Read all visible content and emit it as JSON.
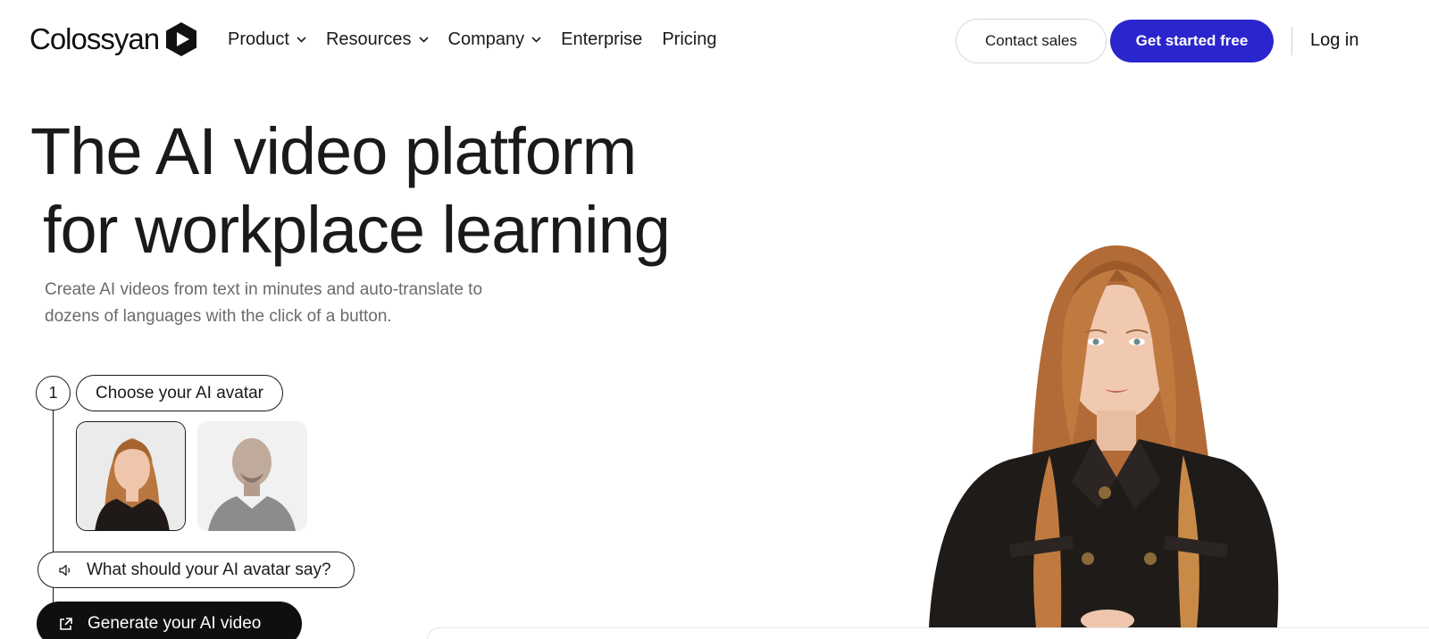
{
  "brand": {
    "name": "Colossyan",
    "accent": "#2a25cc"
  },
  "nav": {
    "links": [
      {
        "label": "Product",
        "has_dropdown": true
      },
      {
        "label": "Resources",
        "has_dropdown": true
      },
      {
        "label": "Company",
        "has_dropdown": true
      },
      {
        "label": "Enterprise",
        "has_dropdown": false
      },
      {
        "label": "Pricing",
        "has_dropdown": false
      }
    ],
    "contact_label": "Contact sales",
    "cta_label": "Get started free",
    "login_label": "Log in"
  },
  "hero": {
    "title_line1": "The AI video platform",
    "title_line2": "for workplace learning",
    "subtitle": "Create AI videos from text in minutes and auto-translate to dozens of languages with the click of a button."
  },
  "stepper": {
    "step_number": "1",
    "choose_label": "Choose your AI avatar",
    "avatars": [
      {
        "name": "woman-avatar",
        "selected": true
      },
      {
        "name": "man-avatar",
        "selected": false
      }
    ],
    "say_label": "What should your AI avatar say?",
    "generate_label": "Generate your AI video"
  },
  "icons": {
    "logo": "play-hexagon-icon",
    "chevron": "chevron-down-icon",
    "speaker": "speaker-icon",
    "generate": "external-link-icon"
  }
}
